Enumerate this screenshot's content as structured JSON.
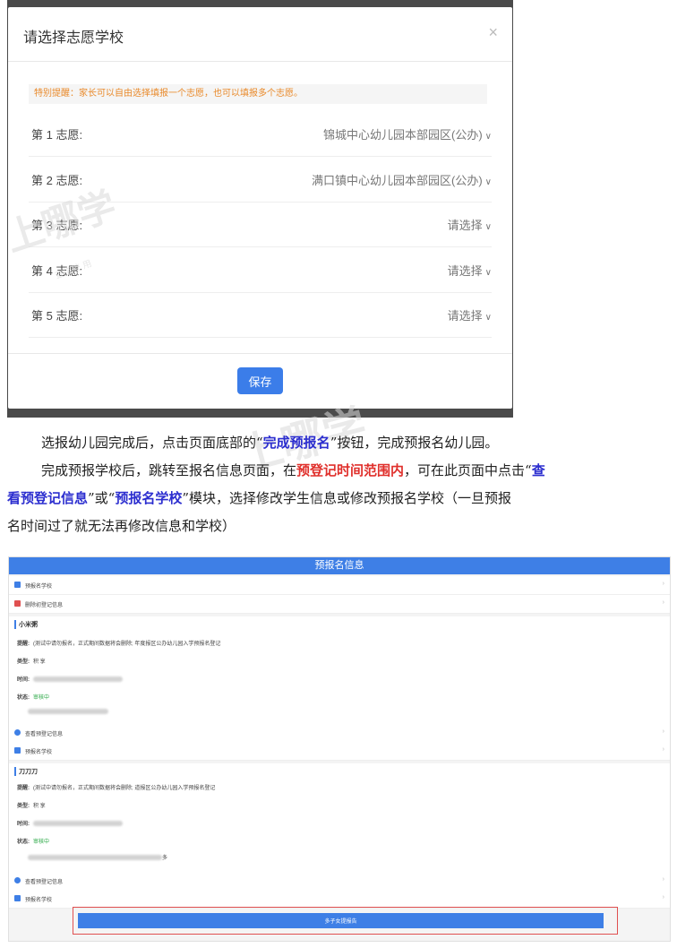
{
  "modal": {
    "title": "请选择志愿学校",
    "close": "×",
    "notice": "特别提醒：家长可以自由选择填报一个志愿，也可以填报多个志愿。",
    "choices": [
      {
        "label": "第 1 志愿:",
        "value": "锦城中心幼儿园本部园区(公办)"
      },
      {
        "label": "第 2 志愿:",
        "value": "满口镇中心幼儿园本部园区(公办)"
      },
      {
        "label": "第 3 志愿:",
        "value": "请选择"
      },
      {
        "label": "第 4 志愿:",
        "value": "请选择"
      },
      {
        "label": "第 5 志愿:",
        "value": "请选择"
      }
    ],
    "save_label": "保存"
  },
  "text": {
    "p1_a": "选报幼儿园完成后，点击页面底部的“",
    "p1_b": "完成预报名",
    "p1_c": "”按钮，完成预报名幼儿园。",
    "p2_a": "完成预报学校后，跳转至报名信息页面，在",
    "p2_b": "预登记时间范围内",
    "p2_c": "，可在此页面中点击“",
    "p2_d": "查",
    "p3_a": "看预登记信息",
    "p3_b": "”或“",
    "p3_c": "预报名学校",
    "p3_d": "”模块，选择修改学生信息或修改预报名学校（一旦预报",
    "p4": "名时间过了就无法再修改信息和学校）"
  },
  "watermark": {
    "main": "上哪学",
    "sub": "查学校 用"
  },
  "info": {
    "header": "预报名信息",
    "top_rows": [
      "预报名学校",
      "删除初登记信息"
    ],
    "students": [
      {
        "name": "小米粥",
        "note_label": "提醒:",
        "note": "(测试中请勿报名，正式期间数据将会删除;   年度报区公办幼儿园入学预报名登记",
        "type_label": "类型:",
        "type_value": "积  享",
        "time_label": "时间:",
        "status_label": "状态:",
        "status_value": "审核中",
        "link1": "查看预登记信息",
        "link2": "预报名学校"
      },
      {
        "name": "刀刀刀",
        "note_label": "提醒:",
        "note": "(测试中请勿报名，正式期间数据将会删除;   道报区公办幼儿园入学预报名登记",
        "type_label": "类型:",
        "type_value": "积  享",
        "time_label": "时间:",
        "status_label": "状态:",
        "status_value": "审核中",
        "extra": "多",
        "link1": "查看预登记信息",
        "link2": "预报名学校"
      }
    ],
    "submit_label": "多子女提报告"
  },
  "colors": {
    "accent": "#3e7fe6",
    "notice": "#e98a2b",
    "emphasis_blue": "#2c2ecf",
    "emphasis_red": "#e0302c",
    "status_green": "#2aa845"
  }
}
